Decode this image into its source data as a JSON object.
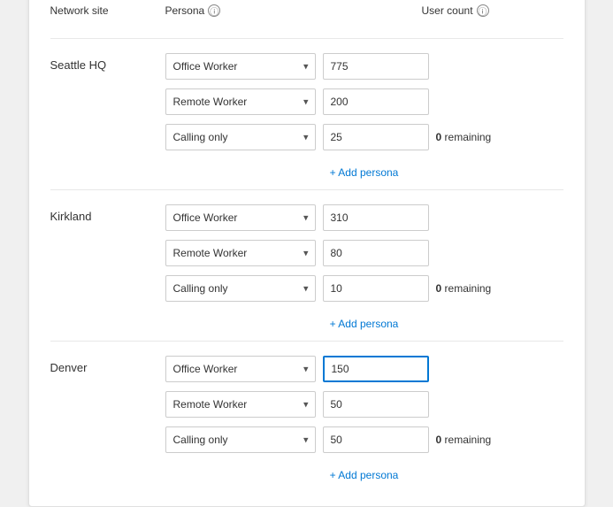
{
  "header": {
    "network_site_label": "Network site",
    "persona_label": "Persona",
    "user_count_label": "User count"
  },
  "sites": [
    {
      "name": "Seattle HQ",
      "personas": [
        {
          "value": "Office Worker",
          "user_count": "775",
          "show_remaining": false,
          "active": false
        },
        {
          "value": "Remote Worker",
          "user_count": "200",
          "show_remaining": false,
          "active": false
        },
        {
          "value": "Calling only",
          "user_count": "25",
          "show_remaining": true,
          "remaining": "0",
          "active": false
        }
      ],
      "add_persona_label": "+ Add persona"
    },
    {
      "name": "Kirkland",
      "personas": [
        {
          "value": "Office Worker",
          "user_count": "310",
          "show_remaining": false,
          "active": false
        },
        {
          "value": "Remote Worker",
          "user_count": "80",
          "show_remaining": false,
          "active": false
        },
        {
          "value": "Calling only",
          "user_count": "10",
          "show_remaining": true,
          "remaining": "0",
          "active": false
        }
      ],
      "add_persona_label": "+ Add persona"
    },
    {
      "name": "Denver",
      "personas": [
        {
          "value": "Office Worker",
          "user_count": "150",
          "show_remaining": false,
          "active": true
        },
        {
          "value": "Remote Worker",
          "user_count": "50",
          "show_remaining": false,
          "active": false
        },
        {
          "value": "Calling only",
          "user_count": "50",
          "show_remaining": true,
          "remaining": "0",
          "active": false
        }
      ],
      "add_persona_label": "+ Add persona"
    }
  ],
  "persona_options": [
    "Office Worker",
    "Remote Worker",
    "Calling only"
  ],
  "remaining_label": "remaining"
}
